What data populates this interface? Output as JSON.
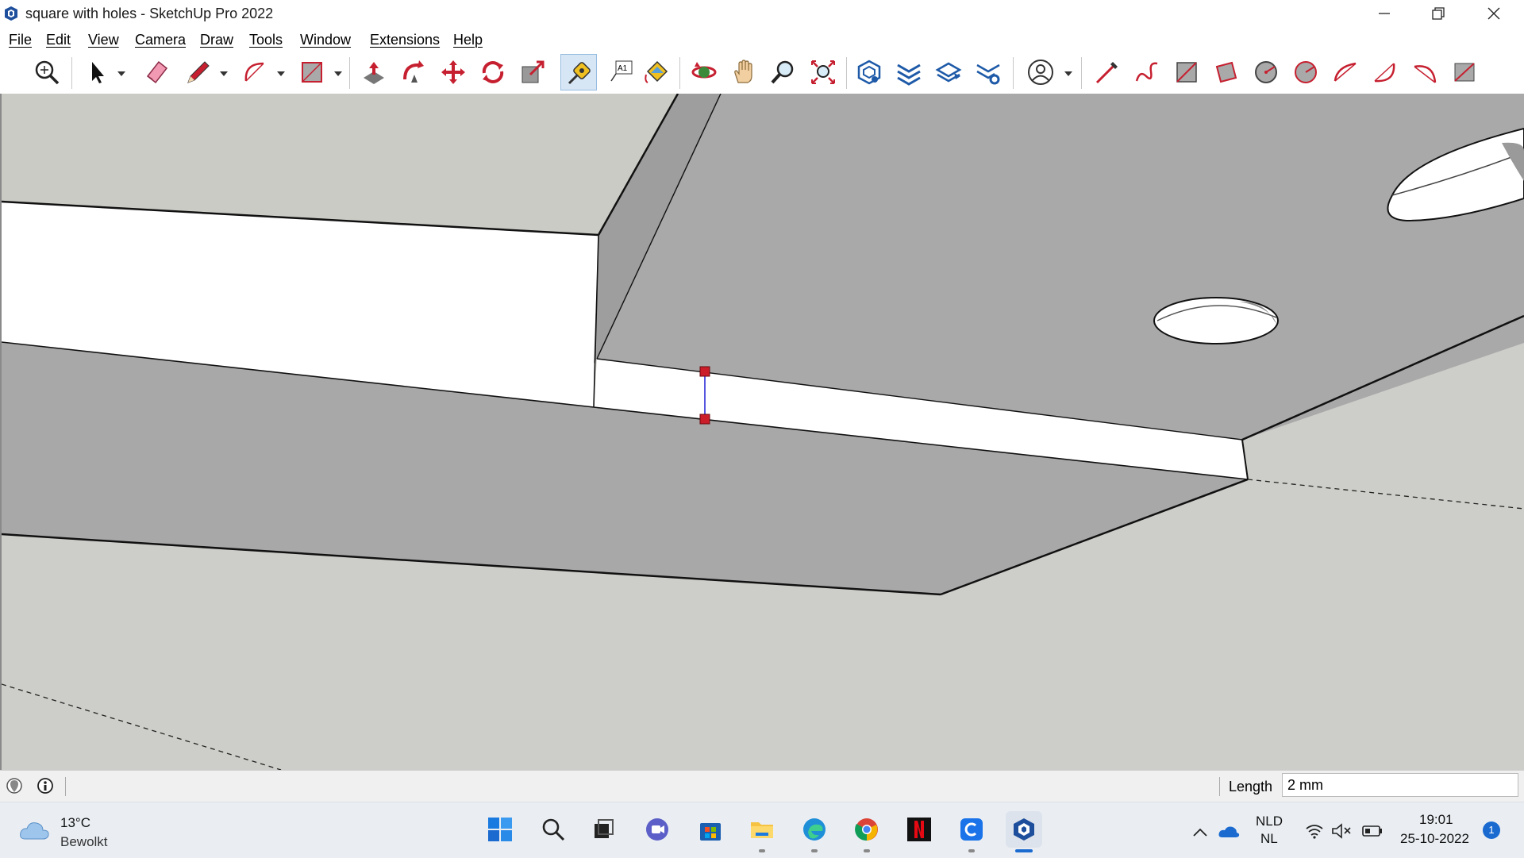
{
  "window": {
    "title": "square with holes - SketchUp Pro 2022"
  },
  "menu": [
    "File",
    "Edit",
    "View",
    "Camera",
    "Draw",
    "Tools",
    "Window",
    "Extensions",
    "Help"
  ],
  "toolbar": {
    "tools": [
      "search-tool",
      "select",
      "eraser",
      "line",
      "arc",
      "shape",
      "push-pull",
      "follow-me",
      "move",
      "rotate",
      "scale",
      "tape-measure",
      "text",
      "paint-bucket",
      "orbit",
      "pan",
      "zoom",
      "zoom-extents",
      "sandbox-from-contours",
      "sandbox-from-scratch",
      "smoove",
      "stamp",
      "profile",
      "freehand",
      "offset",
      "flip-along",
      "dimension",
      "protractor",
      "axes",
      "section-plane",
      "3d-text",
      "lasso"
    ],
    "active_tool": "tape-measure"
  },
  "status": {
    "length_label": "Length",
    "length_value": "2 mm"
  },
  "taskbar": {
    "weather": {
      "temp": "13°C",
      "desc": "Bewolkt"
    },
    "language": {
      "line1": "NLD",
      "line2": "NL"
    },
    "clock": {
      "time": "19:01",
      "date": "25-10-2022"
    },
    "notifications": "1"
  },
  "colors": {
    "viewport_bg": "#cdcdc9",
    "face_gray": "#a7a7a7",
    "face_white": "#ffffff",
    "accent_red": "#cc1e2a",
    "guide_blue": "#2a2ad6"
  }
}
